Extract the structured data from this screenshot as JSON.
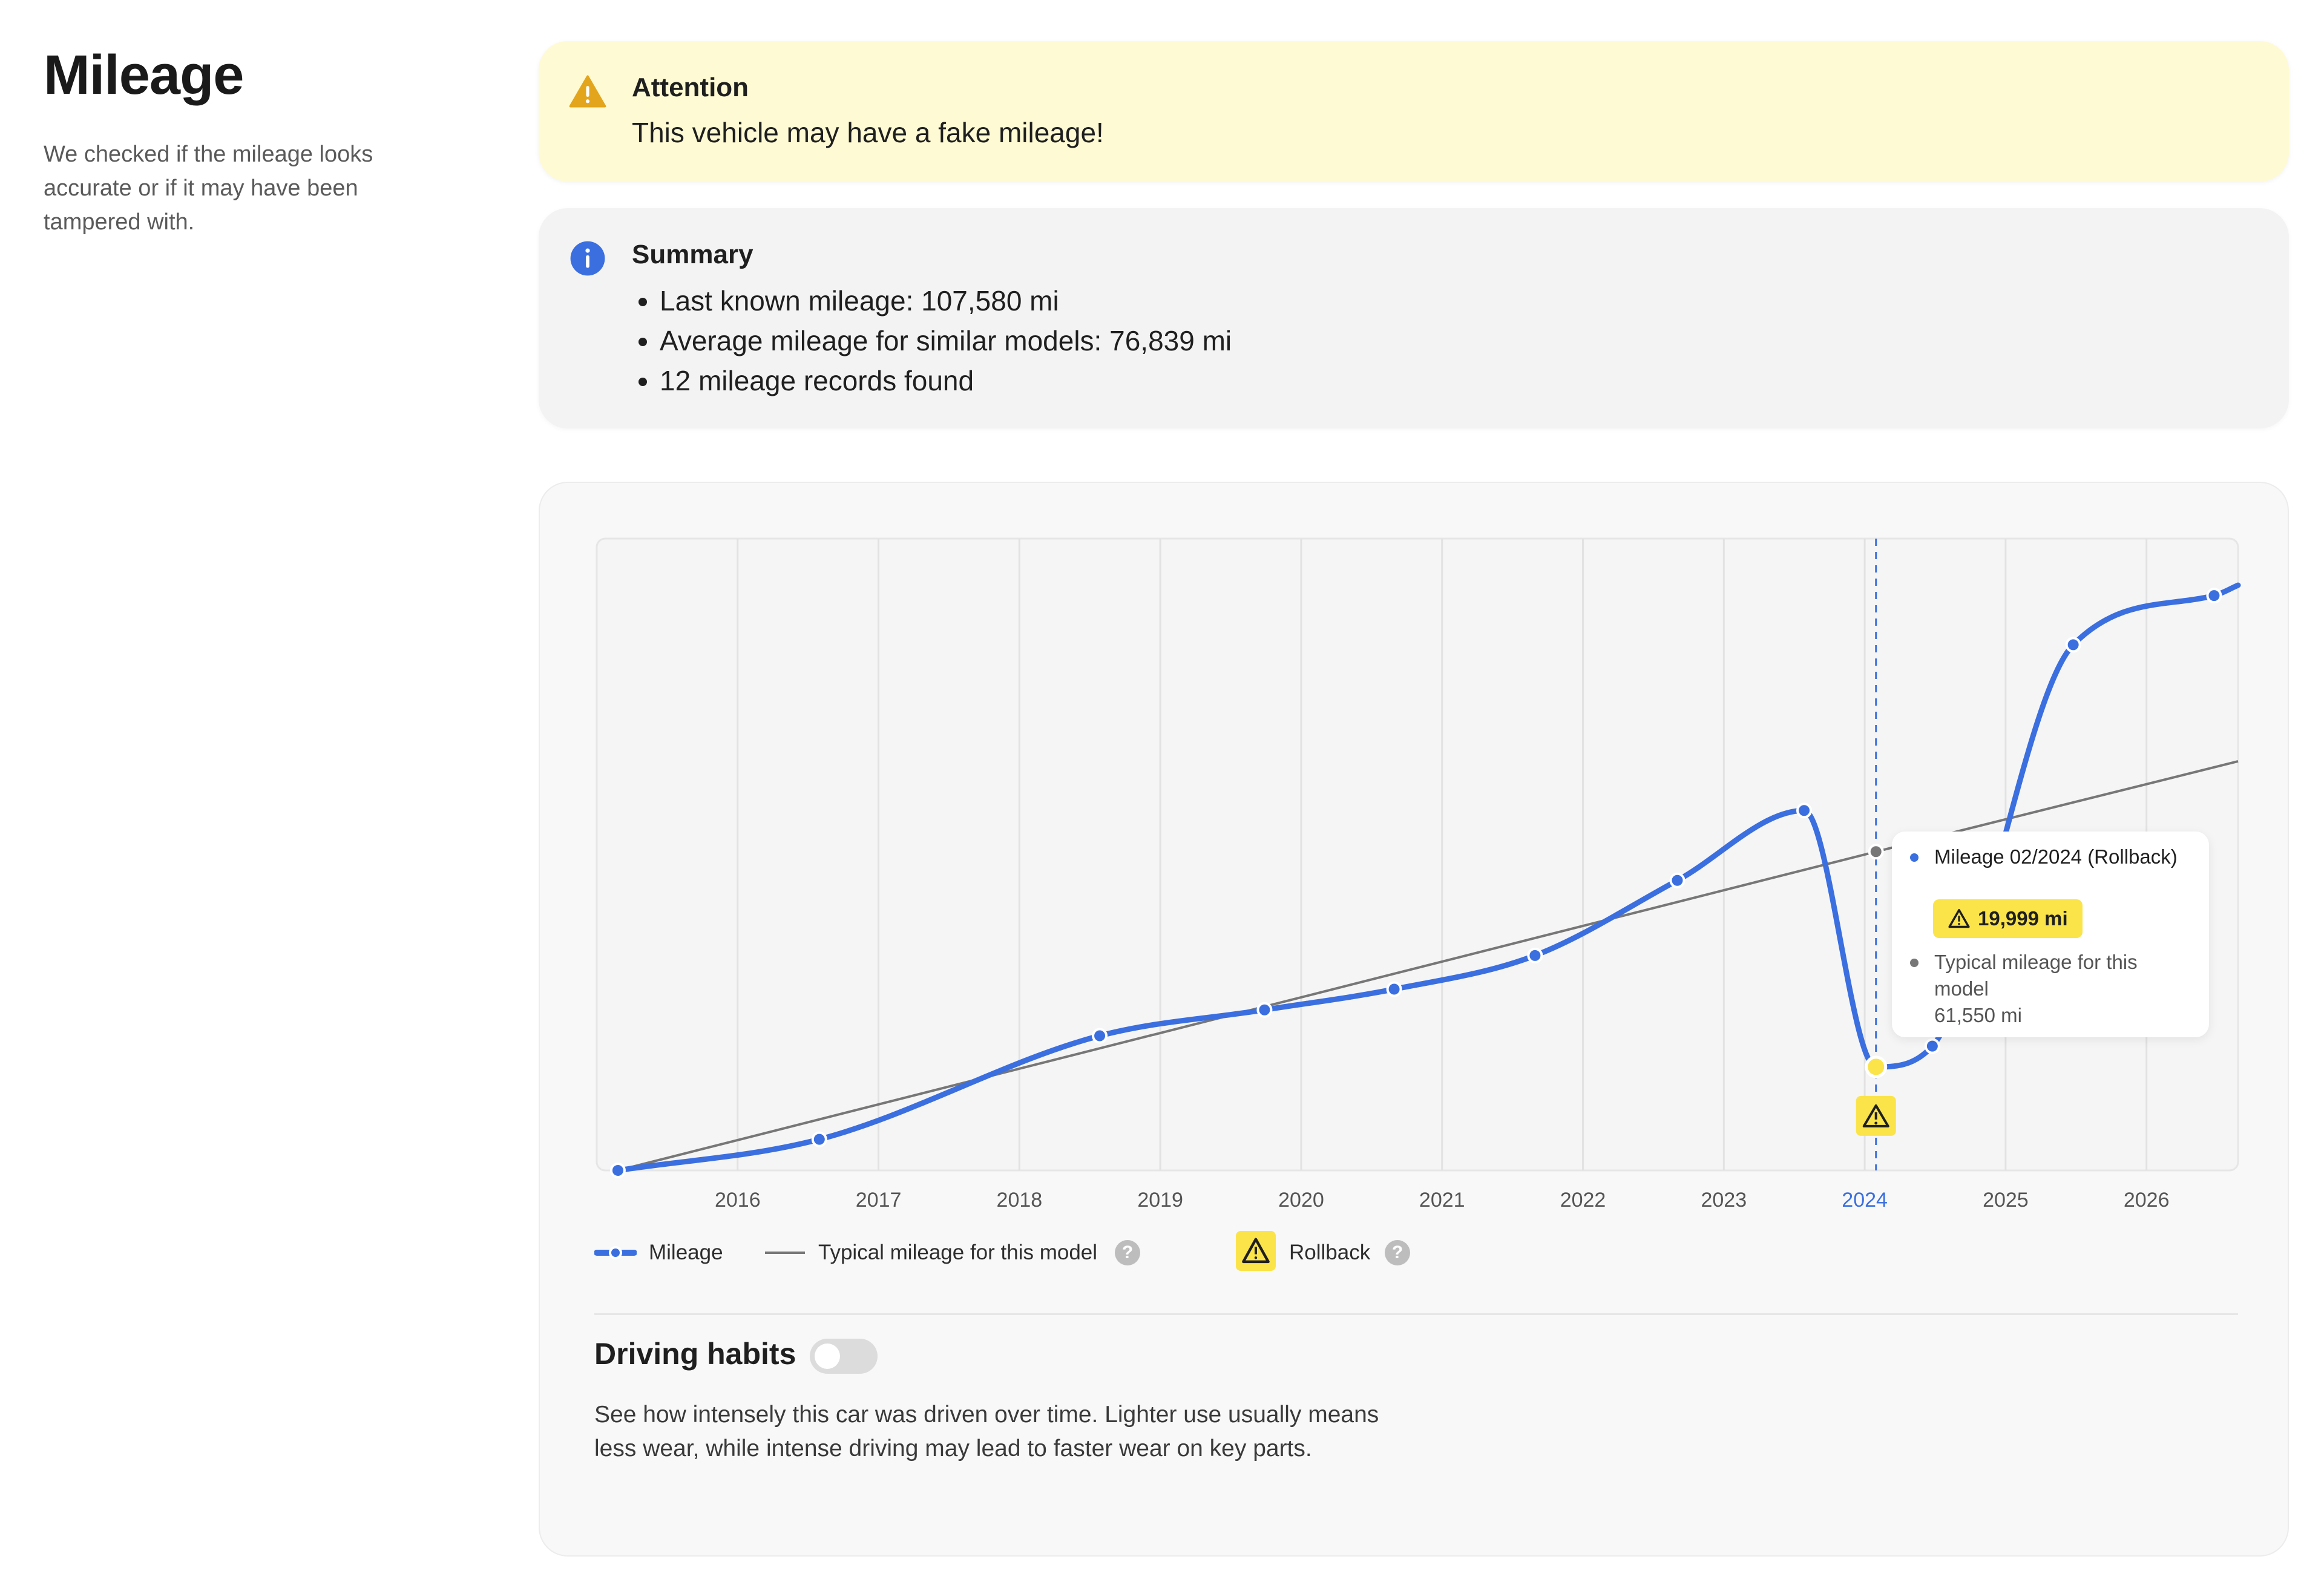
{
  "page": {
    "title": "Mileage",
    "description": "We checked if the mileage looks accurate or if it may have been tampered with."
  },
  "attention": {
    "icon": "warning-triangle-icon",
    "title": "Attention",
    "message": "This vehicle may have a fake mileage!"
  },
  "summary": {
    "icon": "info-icon",
    "title": "Summary",
    "items": [
      "Last known mileage: 107,580 mi",
      "Average mileage for similar models: 76,839 mi",
      "12 mileage records found"
    ]
  },
  "tooltip": {
    "mileage_label": "Mileage 02/2024 (Rollback)",
    "mileage_value": "19,999 mi",
    "typical_label": "Typical mileage for this model",
    "typical_value": "61,550 mi"
  },
  "legend": {
    "mileage": "Mileage",
    "typical": "Typical mileage for this model",
    "rollback": "Rollback",
    "help": "?"
  },
  "driving_habits": {
    "title": "Driving habits",
    "toggle_on": false,
    "description": "See how intensely this car was driven over time. Lighter use usually means less wear, while intense driving may lead to faster wear on key parts."
  },
  "colors": {
    "mileage_line": "#3b6fe0",
    "typical_line": "#777777",
    "rollback": "#fae44a",
    "attention_bg": "#fefad3",
    "warning_icon": "#e3a51c",
    "info_icon": "#3b6fe0"
  },
  "chart_data": {
    "type": "line",
    "x_unit": "year",
    "x_ticks": [
      "2016",
      "2017",
      "2018",
      "2019",
      "2020",
      "2021",
      "2022",
      "2023",
      "2024",
      "2025",
      "2026"
    ],
    "highlighted_tick": "2024",
    "xlim": [
      2015,
      2026.65
    ],
    "ylim": [
      0,
      122000
    ],
    "y_axis_shown": false,
    "grid": "vertical",
    "series": [
      {
        "name": "Mileage",
        "points": [
          {
            "x": 2015.15,
            "y": 0
          },
          {
            "x": 2016.58,
            "y": 6000
          },
          {
            "x": 2018.57,
            "y": 26000
          },
          {
            "x": 2019.74,
            "y": 31000
          },
          {
            "x": 2020.66,
            "y": 35000
          },
          {
            "x": 2021.66,
            "y": 41500
          },
          {
            "x": 2022.67,
            "y": 56000
          },
          {
            "x": 2023.57,
            "y": 69500
          },
          {
            "x": 2024.08,
            "y": 19999,
            "rollback": true
          },
          {
            "x": 2024.48,
            "y": 24000
          },
          {
            "x": 2025.48,
            "y": 101500
          },
          {
            "x": 2026.48,
            "y": 111000
          },
          {
            "x": 2026.65,
            "y": 113000
          }
        ]
      },
      {
        "name": "Typical mileage for this model",
        "points": [
          {
            "x": 2015.15,
            "y": 0
          },
          {
            "x": 2024.08,
            "y": 61550
          },
          {
            "x": 2026.65,
            "y": 79000
          }
        ]
      }
    ],
    "marker": {
      "x": 2024.08,
      "label": "Rollback"
    }
  }
}
